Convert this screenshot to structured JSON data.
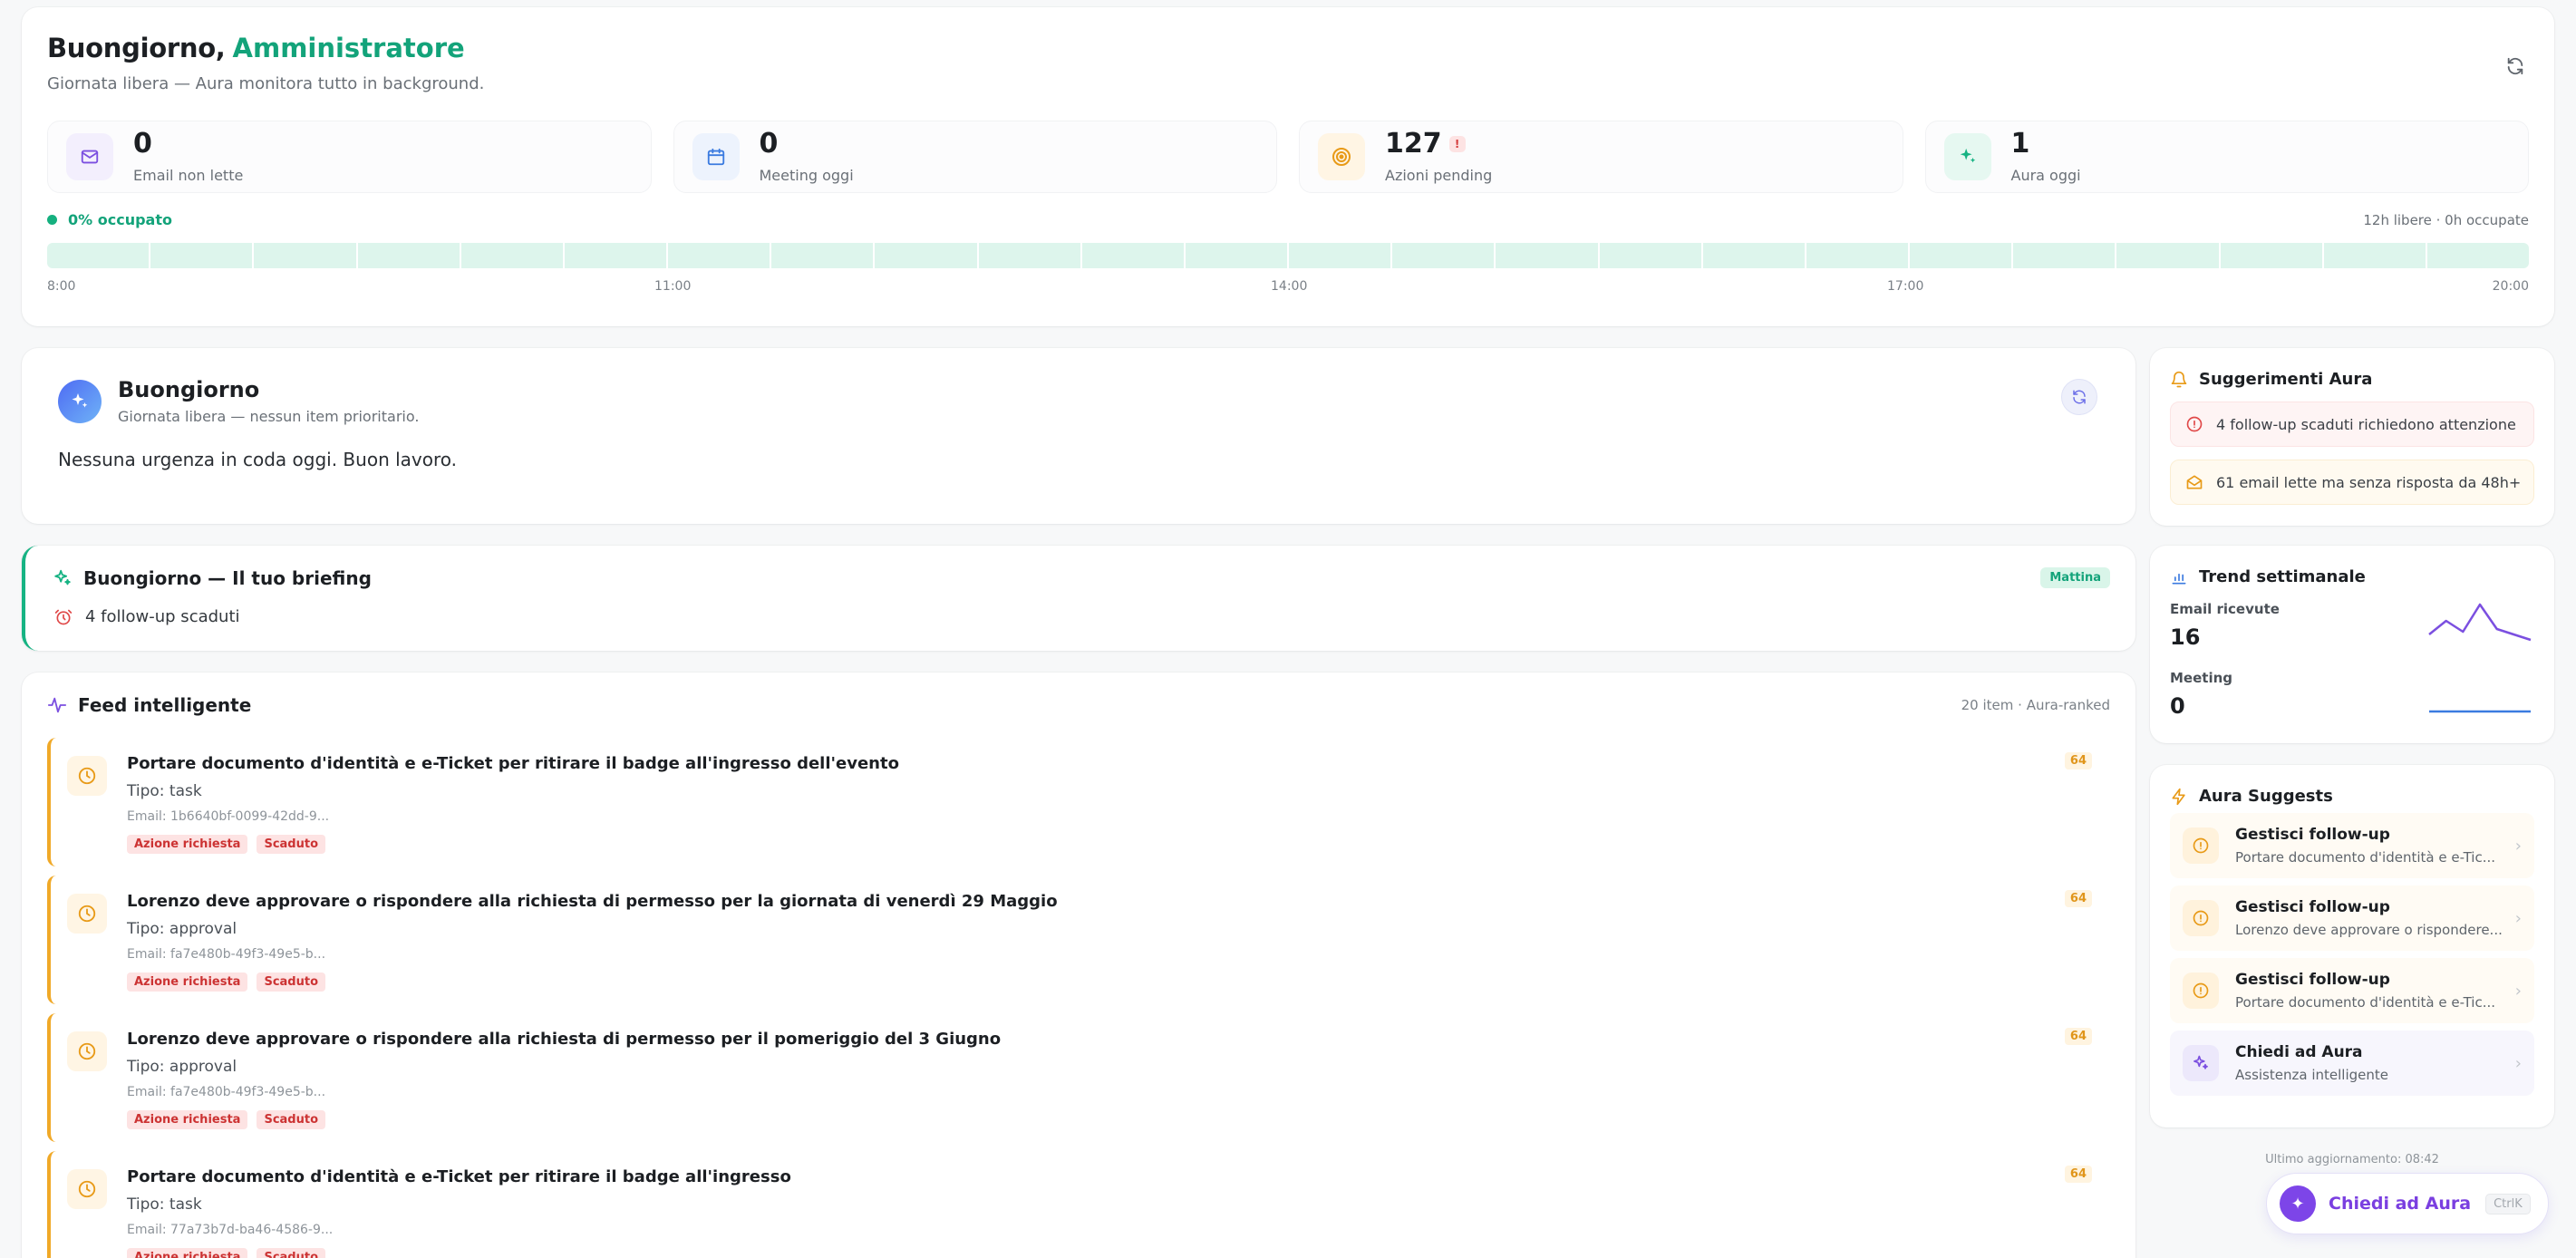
{
  "header": {
    "greeting": "Buongiorno,",
    "user_name": "Amministratore",
    "subtitle": "Giornata libera — Aura monitora tutto in background.",
    "stats": [
      {
        "value": "0",
        "label": "Email non lette",
        "icon": "mail-icon",
        "color": "#7b4fe0",
        "bg": "#f3effd"
      },
      {
        "value": "0",
        "label": "Meeting oggi",
        "icon": "calendar-icon",
        "color": "#3b7be0",
        "bg": "#edf3fd"
      },
      {
        "value": "127",
        "label": "Azioni pending",
        "icon": "target-icon",
        "color": "#e89a17",
        "bg": "#fff5e4",
        "badge": "!"
      },
      {
        "value": "1",
        "label": "Aura oggi",
        "icon": "sparkle-icon",
        "color": "#16b383",
        "bg": "#e6f8f1"
      }
    ],
    "occupancy": "0% occupato",
    "occupancy_summary": "12h libere · 0h occupate",
    "occupancy_fraction": 0,
    "timeline_labels": [
      "8:00",
      "11:00",
      "14:00",
      "17:00",
      "20:00"
    ]
  },
  "morning": {
    "title": "Buongiorno",
    "subtitle": "Giornata libera — nessun item prioritario.",
    "body": "Nessuna urgenza in coda oggi. Buon lavoro."
  },
  "briefing": {
    "title": "Buongiorno — Il tuo briefing",
    "tag": "Mattina",
    "item": "4 follow-up scaduti"
  },
  "feed": {
    "title": "Feed intelligente",
    "meta": "20 item · Aura-ranked",
    "items": [
      {
        "title": "Portare documento d'identità e e-Ticket per ritirare il badge all'ingresso dell'evento",
        "type": "Tipo: task",
        "email": "Email: 1b6640bf-0099-42dd-9...",
        "tags": [
          "Azione richiesta",
          "Scaduto"
        ],
        "score": "64"
      },
      {
        "title": "Lorenzo deve approvare o rispondere alla richiesta di permesso per la giornata di venerdì 29 Maggio",
        "type": "Tipo: approval",
        "email": "Email: fa7e480b-49f3-49e5-b...",
        "tags": [
          "Azione richiesta",
          "Scaduto"
        ],
        "score": "64"
      },
      {
        "title": "Lorenzo deve approvare o rispondere alla richiesta di permesso per il pomeriggio del 3 Giugno",
        "type": "Tipo: approval",
        "email": "Email: fa7e480b-49f3-49e5-b...",
        "tags": [
          "Azione richiesta",
          "Scaduto"
        ],
        "score": "64"
      },
      {
        "title": "Portare documento d'identità e e-Ticket per ritirare il badge all'ingresso",
        "type": "Tipo: task",
        "email": "Email: 77a73b7d-ba46-4586-9...",
        "tags": [
          "Azione richiesta",
          "Scaduto"
        ],
        "score": "64"
      }
    ]
  },
  "suggestions": {
    "title": "Suggerimenti Aura",
    "items": [
      {
        "text": "4 follow-up scaduti richiedono attenzione",
        "icon": "alert-circle-icon",
        "tone": "red"
      },
      {
        "text": "61 email lette ma senza risposta da 48h+",
        "icon": "mail-open-icon",
        "tone": "amber"
      }
    ]
  },
  "trend": {
    "title": "Trend settimanale",
    "rows": [
      {
        "label": "Email ricevute",
        "value": "16",
        "color": "#7b4fe0",
        "series": [
          3,
          8,
          4,
          14,
          5,
          3,
          1
        ]
      },
      {
        "label": "Meeting",
        "value": "0",
        "color": "#3b7be0",
        "series": [
          0,
          0,
          0,
          0,
          0,
          0,
          0
        ]
      }
    ]
  },
  "aura_suggests": {
    "title": "Aura Suggests",
    "items": [
      {
        "title": "Gestisci follow-up",
        "sub": "Portare documento d'identità e e-Tic...",
        "tone": "amber"
      },
      {
        "title": "Gestisci follow-up",
        "sub": "Lorenzo deve approvare o rispondere...",
        "tone": "amber"
      },
      {
        "title": "Gestisci follow-up",
        "sub": "Portare documento d'identità e e-Tic...",
        "tone": "amber"
      },
      {
        "title": "Chiedi ad Aura",
        "sub": "Assistenza intelligente",
        "tone": "purple"
      }
    ]
  },
  "last_update": "Ultimo aggiornamento: 08:42",
  "ask_aura": {
    "label": "Chiedi ad Aura",
    "shortcut": "CtrlK"
  },
  "colors": {
    "accent_green": "#13a37a",
    "accent_purple": "#7d45e8",
    "warning": "#f0a928",
    "danger": "#cc3333"
  }
}
